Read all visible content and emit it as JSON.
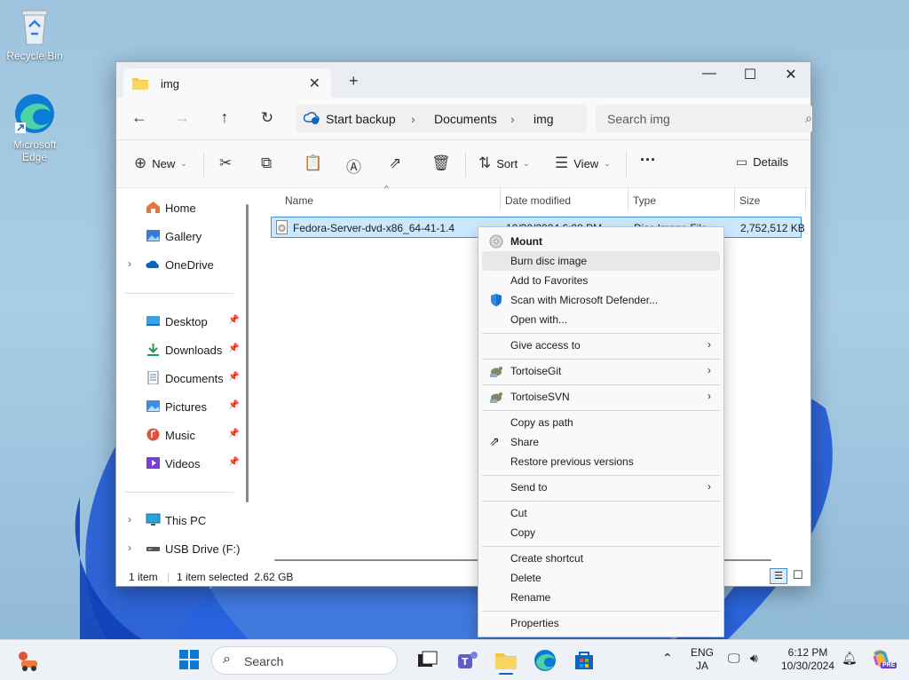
{
  "desktop": {
    "icons": [
      {
        "label": "Recycle Bin"
      },
      {
        "label": "Microsoft Edge"
      }
    ]
  },
  "window": {
    "tab_title": "img",
    "new_tab_label": "+",
    "controls": {
      "minimize": "—",
      "maximize": "☐",
      "close": "✕"
    },
    "breadcrumb": [
      "Start backup",
      "Documents",
      "img"
    ],
    "search_placeholder": "Search img",
    "toolbar": {
      "new_label": "New",
      "sort_label": "Sort",
      "view_label": "View",
      "more_label": "···",
      "details_label": "Details"
    },
    "nav": {
      "home": "Home",
      "gallery": "Gallery",
      "onedrive": "OneDrive",
      "pinned": [
        "Desktop",
        "Downloads",
        "Documents",
        "Pictures",
        "Music",
        "Videos"
      ],
      "this_pc": "This PC",
      "usb": "USB Drive (F:)"
    },
    "columns": [
      "Name",
      "Date modified",
      "Type",
      "Size"
    ],
    "files": [
      {
        "name": "Fedora-Server-dvd-x86_64-41-1.4",
        "date": "10/30/2024 6:08 PM",
        "type": "Disc Image File",
        "size": "2,752,512 KB"
      }
    ],
    "status": {
      "count": "1 item",
      "selected": "1 item selected  2.62 GB"
    }
  },
  "context_menu": {
    "groups": [
      [
        "Mount",
        "Burn disc image",
        "Add to Favorites",
        "Scan with Microsoft Defender...",
        "Open with..."
      ],
      [
        "Give access to"
      ],
      [
        "TortoiseGit"
      ],
      [
        "TortoiseSVN"
      ],
      [
        "Copy as path",
        "Share",
        "Restore previous versions"
      ],
      [
        "Send to"
      ],
      [
        "Cut",
        "Copy"
      ],
      [
        "Create shortcut",
        "Delete",
        "Rename"
      ],
      [
        "Properties"
      ]
    ],
    "highlighted": "Burn disc image"
  },
  "taskbar": {
    "search_placeholder": "Search",
    "lang_top": "ENG",
    "lang_bottom": "JA",
    "time": "6:12 PM",
    "date": "10/30/2024",
    "copilot_badge": "PRE"
  }
}
